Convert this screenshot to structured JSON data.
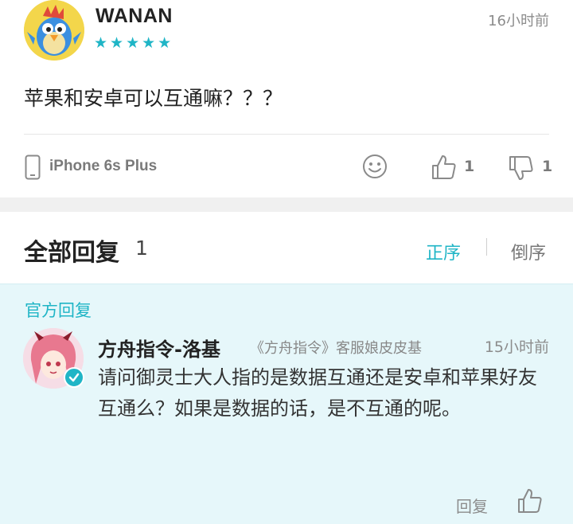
{
  "post": {
    "username": "WANAN",
    "stars": "★★★★★",
    "rating": 5,
    "time": "16小时前",
    "content": "苹果和安卓可以互通嘛？？？",
    "device": "iPhone 6s Plus",
    "like_count": "1",
    "dislike_count": "1"
  },
  "replies": {
    "title": "全部回复",
    "count": "1",
    "sort_asc": "正序",
    "sort_desc": "倒序"
  },
  "official_reply": {
    "label": "官方回复",
    "name": "方舟指令-洛基",
    "role": "《方舟指令》客服娘皮皮基",
    "time": "15小时前",
    "text": "请问御灵士大人指的是数据互通还是安卓和苹果好友互通么？如果是数据的话，是不互通的呢。",
    "reply_label": "回复"
  },
  "colors": {
    "accent": "#1fb5c6",
    "official_bg": "#e6f7fa",
    "separator_bg": "#f0f0f0"
  },
  "icons": {
    "avatar": "chicken-avatar",
    "device": "phone-icon",
    "emoji": "smiley-icon",
    "like": "thumbs-up-icon",
    "dislike": "thumbs-down-icon",
    "verified": "check-badge-icon"
  }
}
